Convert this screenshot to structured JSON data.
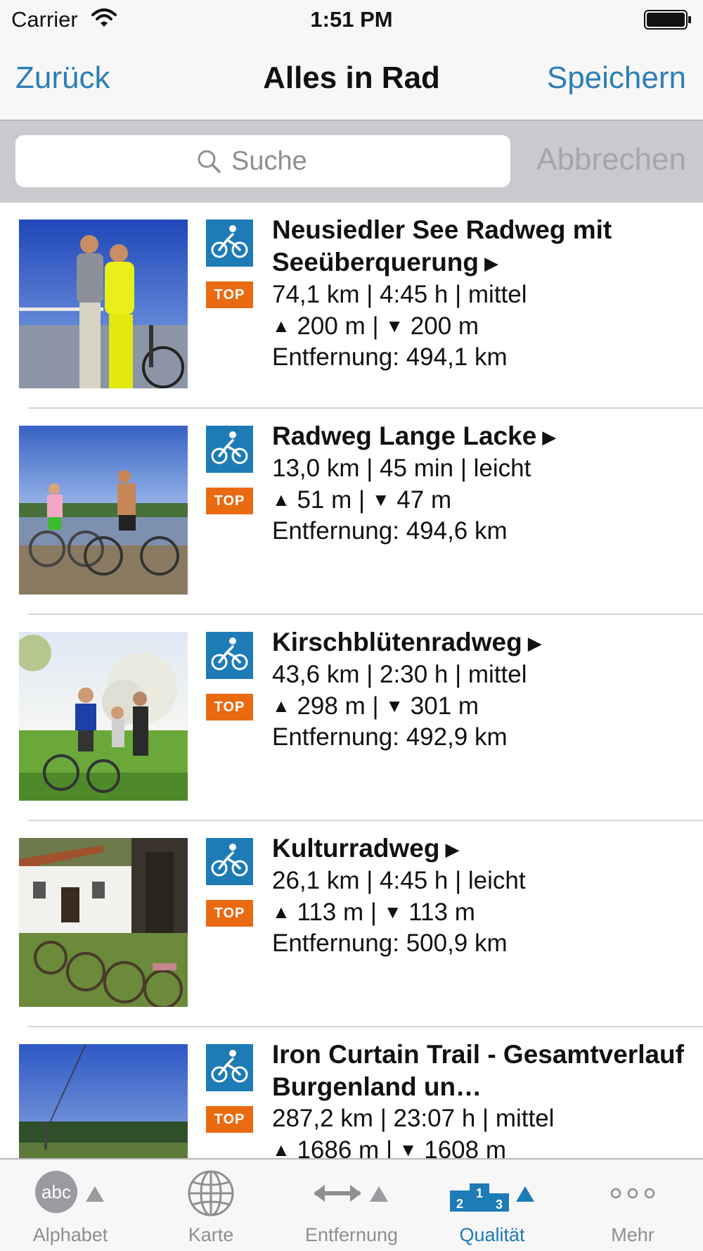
{
  "status_bar": {
    "carrier": "Carrier",
    "time": "1:51 PM"
  },
  "nav": {
    "back": "Zurück",
    "title": "Alles in Rad",
    "save": "Speichern"
  },
  "search": {
    "placeholder": "Suche",
    "cancel": "Abbrechen"
  },
  "colors": {
    "accent": "#2c7eb7",
    "bike_badge": "#1d7bb5",
    "top_badge": "#ea6a12"
  },
  "badges": {
    "top": "TOP"
  },
  "routes": [
    {
      "title": "Neusiedler See Radweg mit Seeüberquerung",
      "stats": "74,1 km | 4:45 h | mittel",
      "ascent": "200 m",
      "descent": "200 m",
      "distance": "Entfernung: 494,1 km"
    },
    {
      "title": "Radweg Lange Lacke",
      "stats": "13,0 km | 45 min | leicht",
      "ascent": "51 m",
      "descent": "47 m",
      "distance": "Entfernung: 494,6 km"
    },
    {
      "title": "Kirschblütenradweg",
      "stats": "43,6 km | 2:30 h | mittel",
      "ascent": "298 m",
      "descent": "301 m",
      "distance": "Entfernung: 492,9 km"
    },
    {
      "title": "Kulturradweg",
      "stats": "26,1 km | 4:45 h | leicht",
      "ascent": "113 m",
      "descent": "113 m",
      "distance": "Entfernung: 500,9 km"
    },
    {
      "title": "Iron Curtain Trail - Gesamtverlauf Burgenland un…",
      "stats": "287,2 km | 23:07 h | mittel",
      "ascent": "1686 m",
      "descent": "1608 m",
      "distance": ""
    }
  ],
  "tabs": [
    {
      "label": "Alphabet",
      "icon": "abc-circle-icon"
    },
    {
      "label": "Karte",
      "icon": "globe-icon"
    },
    {
      "label": "Entfernung",
      "icon": "double-arrow-icon"
    },
    {
      "label": "Qualität",
      "icon": "podium-icon"
    },
    {
      "label": "Mehr",
      "icon": "more-dots-icon"
    }
  ],
  "tab_icon_text": {
    "abc": "abc",
    "podium_first": "1",
    "podium_second": "2",
    "podium_third": "3"
  }
}
